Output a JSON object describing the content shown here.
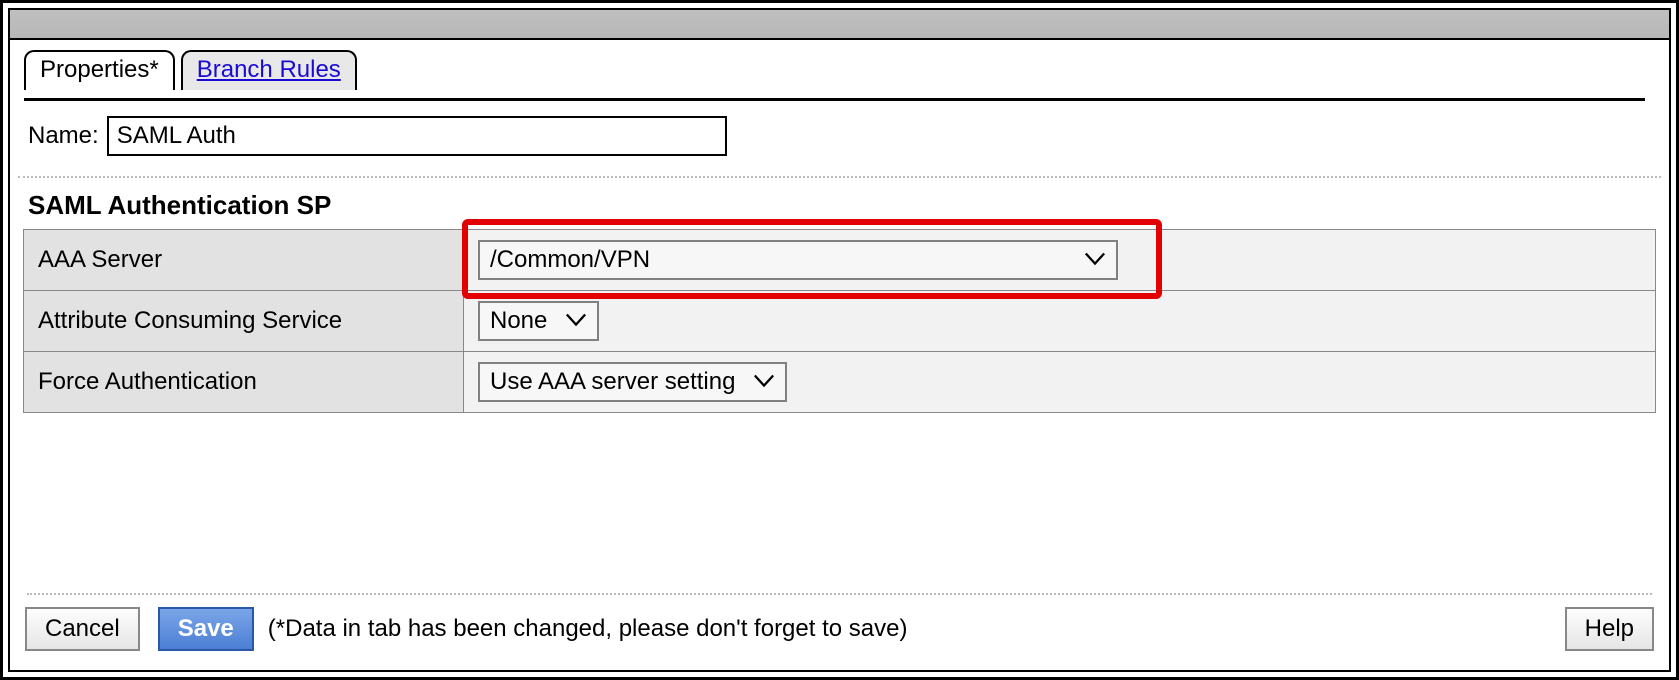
{
  "tabs": {
    "properties": "Properties*",
    "branch_rules": "Branch Rules"
  },
  "name_field": {
    "label": "Name:",
    "value": "SAML Auth"
  },
  "section_title": "SAML Authentication SP",
  "rows": {
    "aaa_server": {
      "label": "AAA Server",
      "value": "/Common/VPN"
    },
    "attribute_consuming_service": {
      "label": "Attribute Consuming Service",
      "value": "None"
    },
    "force_authentication": {
      "label": "Force Authentication",
      "value": "Use AAA server setting"
    }
  },
  "footer": {
    "cancel": "Cancel",
    "save": "Save",
    "message": "(*Data in tab has been changed, please don't forget to save)",
    "help": "Help"
  }
}
